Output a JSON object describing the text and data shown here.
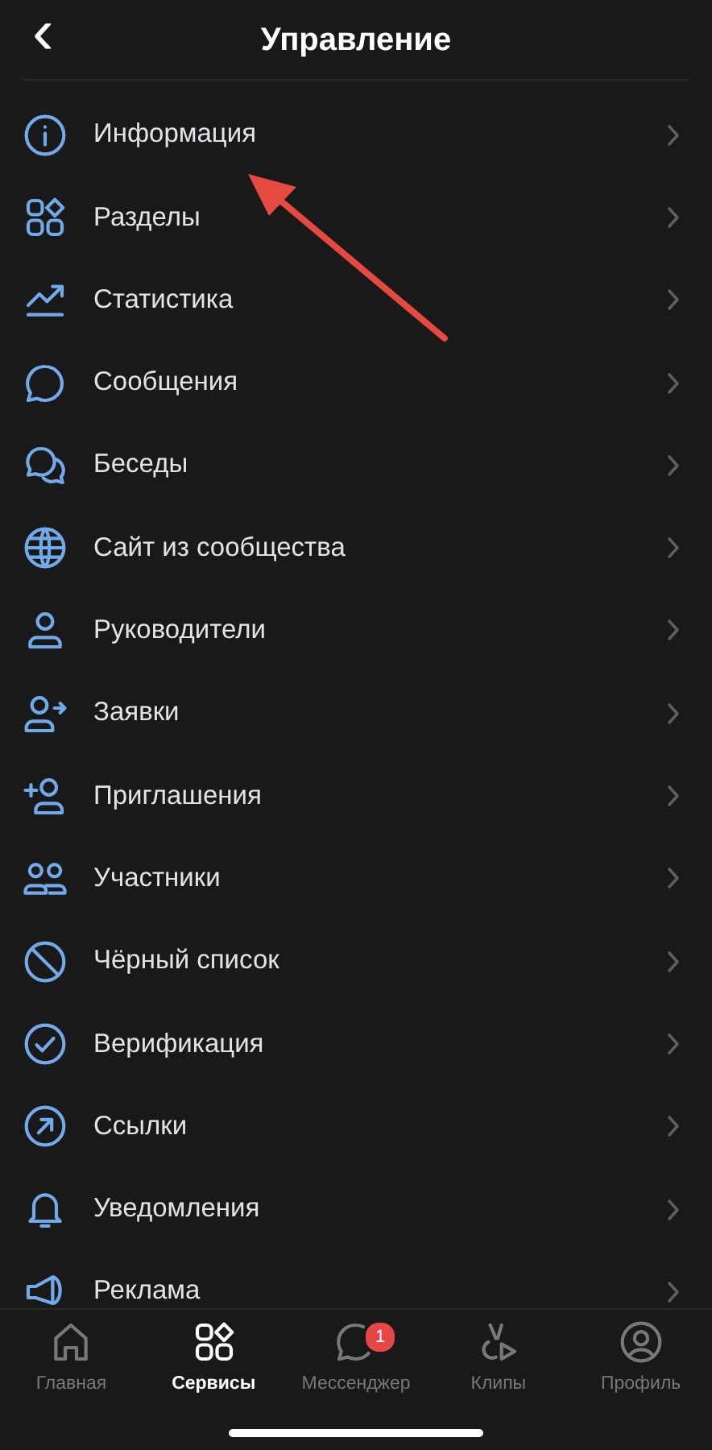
{
  "header": {
    "back": "‹",
    "title": "Управление"
  },
  "menu": [
    {
      "label": "Информация"
    },
    {
      "label": "Разделы"
    },
    {
      "label": "Статистика"
    },
    {
      "label": "Сообщения"
    },
    {
      "label": "Беседы"
    },
    {
      "label": "Сайт из сообщества"
    },
    {
      "label": "Руководители"
    },
    {
      "label": "Заявки"
    },
    {
      "label": "Приглашения"
    },
    {
      "label": "Участники"
    },
    {
      "label": "Чёрный список"
    },
    {
      "label": "Верификация"
    },
    {
      "label": "Ссылки"
    },
    {
      "label": "Уведомления"
    },
    {
      "label": "Реклама"
    }
  ],
  "tab_bar": [
    {
      "label": "Главная",
      "selected": false
    },
    {
      "label": "Сервисы",
      "selected": true
    },
    {
      "label": "Мессенджер",
      "selected": false,
      "badge": "1"
    },
    {
      "label": "Клипы",
      "selected": false
    },
    {
      "label": "Профиль",
      "selected": false
    }
  ]
}
